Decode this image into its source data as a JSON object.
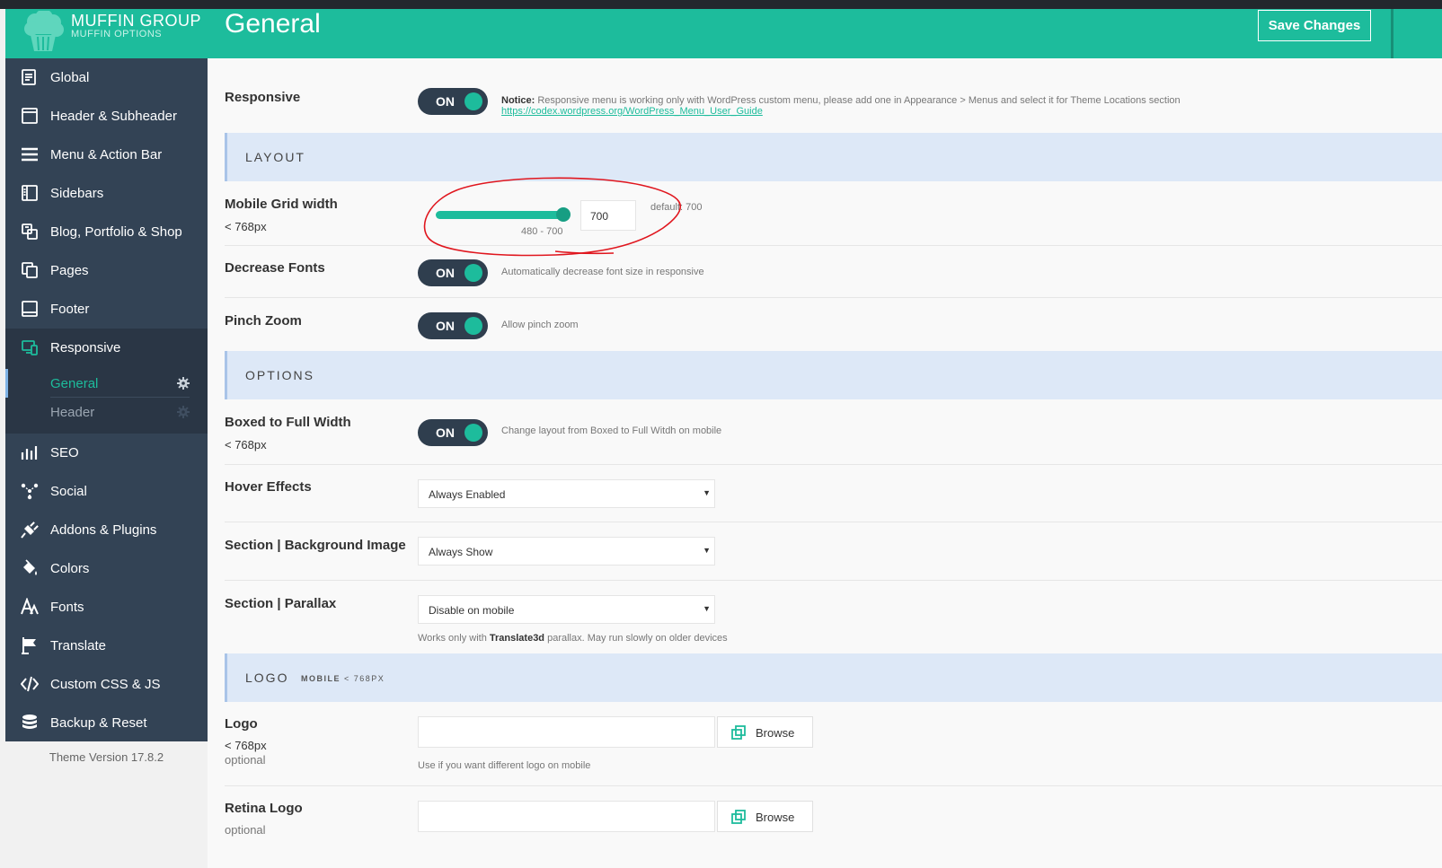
{
  "brand": {
    "name": "MUFFIN GROUP",
    "subtitle": "MUFFIN OPTIONS"
  },
  "sidebar": {
    "items": [
      {
        "label": "Global",
        "icon": "document-edit-icon"
      },
      {
        "label": "Header & Subheader",
        "icon": "window-icon"
      },
      {
        "label": "Menu & Action Bar",
        "icon": "hamburger-menu-icon"
      },
      {
        "label": "Sidebars",
        "icon": "sidebar-layout-icon"
      },
      {
        "label": "Blog, Portfolio & Shop",
        "icon": "gallery-icon"
      },
      {
        "label": "Pages",
        "icon": "pages-copy-icon"
      },
      {
        "label": "Footer",
        "icon": "footer-layout-icon"
      },
      {
        "label": "Responsive",
        "icon": "devices-icon"
      },
      {
        "label": "SEO",
        "icon": "bar-chart-icon"
      },
      {
        "label": "Social",
        "icon": "share-network-icon"
      },
      {
        "label": "Addons & Plugins",
        "icon": "plug-icon"
      },
      {
        "label": "Colors",
        "icon": "paint-bucket-icon"
      },
      {
        "label": "Fonts",
        "icon": "font-icon"
      },
      {
        "label": "Translate",
        "icon": "flag-icon"
      },
      {
        "label": "Custom CSS & JS",
        "icon": "code-icon"
      },
      {
        "label": "Backup & Reset",
        "icon": "database-icon"
      }
    ],
    "subitems": [
      {
        "label": "General",
        "icon": "gear-icon"
      },
      {
        "label": "Header",
        "icon": "gear-icon"
      }
    ],
    "version": "Theme Version 17.8.2"
  },
  "header": {
    "title": "General",
    "save_label": "Save Changes"
  },
  "fields": {
    "responsive": {
      "label": "Responsive",
      "toggle": "ON",
      "notice_bold": "Notice:",
      "notice_text": "Responsive menu is working only with WordPress custom menu, please add one in Appearance > Menus and select it for Theme Locations section",
      "notice_link": "https://codex.wordpress.org/WordPress_Menu_User_Guide"
    },
    "layout_title": "LAYOUT",
    "mobile_grid": {
      "label": "Mobile Grid width",
      "sub": "< 768px",
      "value": "700",
      "range": "480 - 700",
      "default": "default: 700",
      "slider_level_percent": 100
    },
    "decrease_fonts": {
      "label": "Decrease Fonts",
      "toggle": "ON",
      "desc": "Automatically decrease font size in responsive"
    },
    "pinch_zoom": {
      "label": "Pinch Zoom",
      "toggle": "ON",
      "desc": "Allow pinch zoom"
    },
    "options_title": "OPTIONS",
    "boxed": {
      "label": "Boxed to Full Width",
      "sub": "< 768px",
      "toggle": "ON",
      "desc": "Change layout from Boxed to Full Witdh on mobile"
    },
    "hover": {
      "label": "Hover Effects",
      "value": "Always Enabled"
    },
    "bg_image": {
      "label": "Section | Background Image",
      "value": "Always Show"
    },
    "parallax": {
      "label": "Section | Parallax",
      "value": "Disable on mobile",
      "desc_pre": "Works only with",
      "desc_bold": "Translate3d",
      "desc_post": "parallax. May run slowly on older devices"
    },
    "logo_title": "LOGO",
    "logo_sub_bold": "MOBILE",
    "logo_sub_rest": "< 768PX",
    "logo": {
      "label": "Logo",
      "sub": "< 768px",
      "opt": "optional",
      "browse": "Browse",
      "desc": "Use if you want different logo on mobile"
    },
    "retina": {
      "label": "Retina Logo",
      "opt": "optional",
      "browse": "Browse"
    }
  },
  "colors": {
    "accent": "#1dbc9c",
    "sidebar": "#334355",
    "annotation": "#e0161e"
  }
}
